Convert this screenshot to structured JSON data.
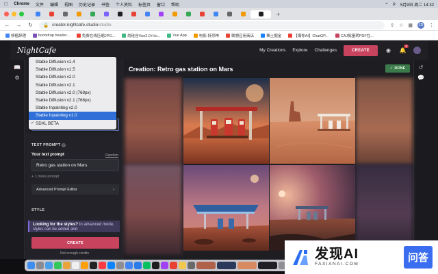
{
  "menubar": {
    "app": "Chrome",
    "items": [
      "文件",
      "编辑",
      "视图",
      "历史记录",
      "书签",
      "个人资料",
      "标签页",
      "窗口",
      "帮助"
    ],
    "datetime": "5月9日 周二 14:32"
  },
  "tabs": [
    "",
    "",
    "",
    "",
    "",
    "",
    "",
    "",
    "",
    "",
    "",
    "",
    "",
    "",
    "",
    "",
    ""
  ],
  "address": {
    "domain": "creator.nightcafe.studio",
    "path": "/studio",
    "avatar": "ZD"
  },
  "bookmarks": [
    "移植辞理",
    "bootstrap header...",
    "免费在线压缩JPG...",
    "尚硅谷Vue2.0+Vu...",
    "Vue App",
    "电影-好恐怖",
    "联想应用商店",
    "稀土掘金",
    "【爆你AI】ChatGP...",
    "CAJ批量转PDF在..."
  ],
  "header": {
    "logo": "NightCafe",
    "nav": [
      "My Creations",
      "Explore",
      "Challenges"
    ],
    "create": "CREATE",
    "badge": "8"
  },
  "panel": {
    "text_prompt_label": "TEXT PROMPT",
    "prompt_label": "Your text prompt",
    "random": "Random",
    "prompt_value": "Retro gas station on Mars",
    "more_prompt": "+ 1 more prompt",
    "advanced": "Advanced Prompt Editor",
    "style_label": "STYLE",
    "styles_hint_bold": "Looking for the styles?",
    "styles_hint_rest": " In advanced mode, styles can be added and",
    "create": "CREATE",
    "credits": "Not enough credits"
  },
  "dropdown": {
    "options": [
      "Stable Diffusion v1.4",
      "Stable Diffusion v1.5",
      "Stable Diffusion v2.0",
      "Stable Diffusion v2.1",
      "Stable Diffusion v2.0 (768px)",
      "Stable Diffusion v2.1 (768px)",
      "Stable Inpainting v2.0",
      "Stable Inpainting v1.0",
      "SDXL BETA"
    ],
    "highlighted": "Stable Inpainting v1.0",
    "checked": "SDXL BETA"
  },
  "main": {
    "title": "Creation: Retro gas station on Mars",
    "done": "DONE"
  },
  "watermark": {
    "main": "发现AI",
    "sub": "FAXIANAI.COM",
    "qa": "问答"
  },
  "colors": {
    "accent": "#c8435e",
    "select_blue": "#2f6fd7",
    "done_green": "#3b7a4a"
  }
}
